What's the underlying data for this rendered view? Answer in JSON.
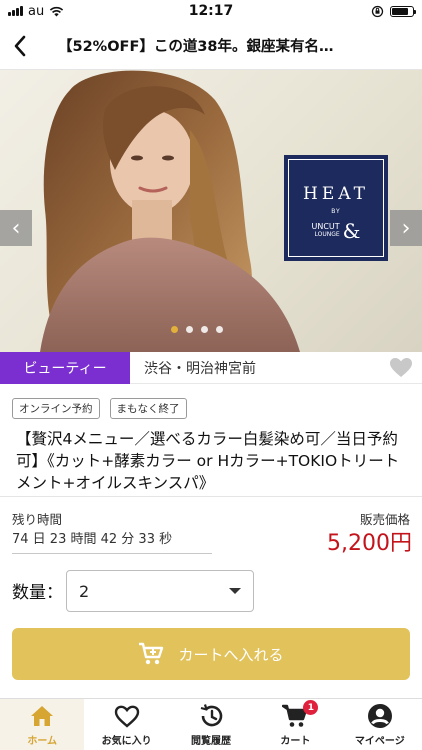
{
  "status_bar": {
    "carrier": "au",
    "time": "12:17"
  },
  "nav": {
    "title": "【52%OFF】この道38年。銀座某有名…"
  },
  "hero": {
    "logo_title": "HEAT",
    "logo_by": "BY",
    "logo_brand_line1": "UNCUT",
    "logo_brand_line2": "LOUNGE",
    "logo_amp": "&",
    "slide_count": 4,
    "active_slide": 1,
    "prev_arrow": "‹",
    "next_arrow": "›"
  },
  "category": {
    "label": "ビューティー",
    "area": "渋谷・明治神宮前"
  },
  "tags": [
    "オンライン予約",
    "まもなく終了"
  ],
  "product": {
    "title": "【贅沢4メニュー／選べるカラー白髪染め可／当日予約可】《カット+酵素カラー or Hカラー+TOKIOトリートメント+オイルスキンスパ》"
  },
  "timer": {
    "label": "残り時間",
    "value": "74 日 23 時間 42 分 33 秒"
  },
  "price": {
    "label": "販売価格",
    "value": "5,200円"
  },
  "quantity": {
    "label": "数量：",
    "value": "2"
  },
  "cart_button": {
    "label": "カートへ入れる"
  },
  "tab_bar": {
    "home": "ホーム",
    "favorites": "お気に入り",
    "history": "閲覧履歴",
    "cart": "カート",
    "cart_badge": "1",
    "mypage": "マイページ"
  },
  "colors": {
    "category": "#7b2fd0",
    "price": "#c3141c",
    "cart_button": "#e2c25b",
    "active_tab": "#d6a532",
    "logo_bg": "#1c2a5e"
  }
}
